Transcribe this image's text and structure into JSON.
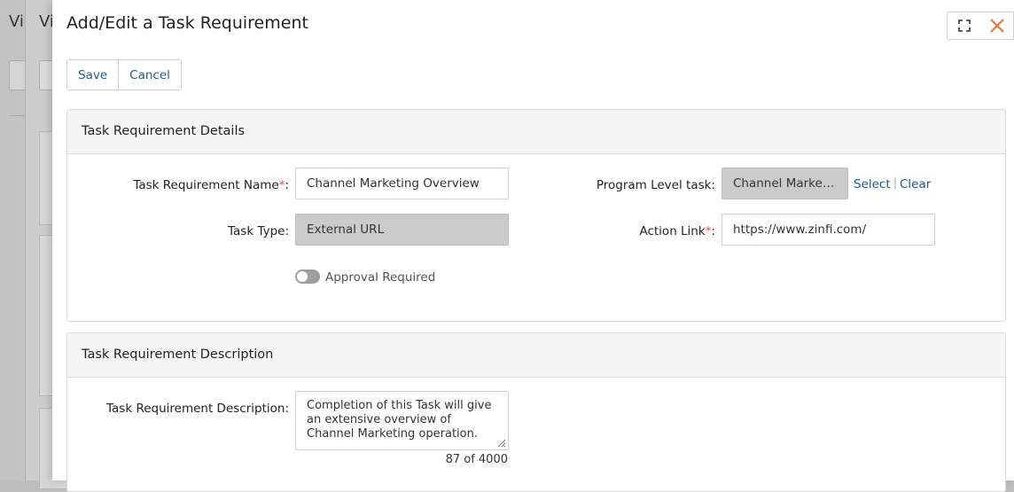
{
  "background": {
    "window1_title": "Vi",
    "window2_title": "Vi"
  },
  "dialog": {
    "title": "Add/Edit a Task Requirement",
    "buttons": {
      "save": "Save",
      "cancel": "Cancel"
    }
  },
  "details": {
    "heading": "Task Requirement Details",
    "name_label": "Task Requirement Name",
    "name_value": "Channel Marketing Overview",
    "task_type_label": "Task Type:",
    "task_type_value": "External URL",
    "approval_label": "Approval Required",
    "approval_on": false,
    "program_level_label": "Program Level task:",
    "program_level_value": "Channel Marketing Overview",
    "select_link": "Select",
    "separator": "|",
    "clear_link": "Clear",
    "action_link_label": "Action Link",
    "action_link_value": "https://www.zinfi.com/",
    "required_mark": "*",
    "colon": ":"
  },
  "description": {
    "heading": "Task Requirement Description",
    "label": "Task Requirement Description:",
    "value": "Completion of this Task will give an extensive overview of Channel Marketing operation.",
    "counter": "87 of 4000"
  },
  "colors": {
    "link": "#1d5a8e",
    "close": "#e8733a",
    "required": "#d9534f"
  }
}
